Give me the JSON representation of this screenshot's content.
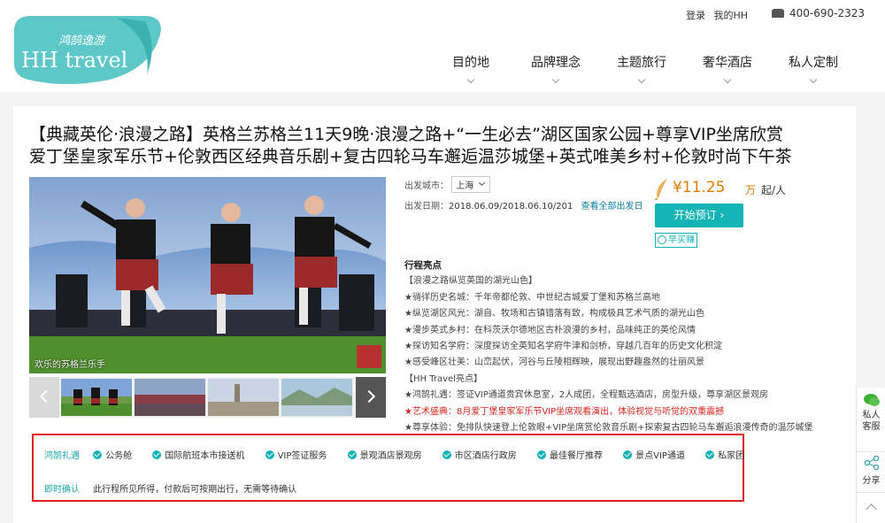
{
  "header": {
    "login": "登录",
    "my_hh": "我的HH",
    "phone": "400-690-2323",
    "logo_cn": "鸿鹄逸游",
    "logo_en": "HH travel",
    "nav": [
      {
        "label": "目的地"
      },
      {
        "label": "品牌理念"
      },
      {
        "label": "主题旅行"
      },
      {
        "label": "奢华酒店"
      },
      {
        "label": "私人定制"
      }
    ]
  },
  "product": {
    "title_line1": "【典藏英伦·浪漫之路】英格兰苏格兰11天9晚·浪漫之路+“一生必去”湖区国家公园+尊享VIP坐席欣赏",
    "title_line2": "爱丁堡皇家军乐节+伦敦西区经典音乐剧+复古四轮马车邂逅温莎城堡+英式唯美乡村+伦敦时尚下午茶",
    "photo_caption": "欢乐的苏格兰乐手",
    "departure_label": "出发城市：",
    "departure_value": "上海",
    "date_label": "出发日期：",
    "date_value": "2018.06.09/2018.06.10/201",
    "all_dates_link": "查看全部出发日",
    "price": "¥11.25",
    "price_unit": "万",
    "price_per": "起/人",
    "book_button": "开始预订",
    "early_button": "早买赚"
  },
  "highlights": {
    "title": "行程亮点",
    "lines": [
      "【浪漫之路纵览英国的湖光山色】",
      "★徜徉历史名城：千年帝都伦敦、中世纪古城爱丁堡和苏格兰高地",
      "★纵览湖区风光：湖自、牧场和古镇错落有致，构成极具艺术气质的湖光山色",
      "★漫步英式乡村：在科茨沃尔德地区古朴浪漫的乡村，品味纯正的英伦风情",
      "★探访知名学府：深度探访全英知名学府牛津和剑桥，穿越几百年的历史文化积淀",
      "★感受峰区壮美：山峦起伏，河谷与丘陵相辉映，展现出野趣盎然的壮丽风景",
      "【HH Travel亮点】",
      "★鸿鹄礼遇：签证VIP通道贵宾休息室，2人成团，全程甄选酒店，房型升级，尊享湖区景观房"
    ],
    "red_line": "★艺术盛典：8月爱丁堡皇家军乐节VIP坐席观看演出，体验视觉与听觉的双重震撼",
    "last_line": "★尊享体验：免排队快速登上伦敦眼+VIP坐席赏伦敦音乐剧+探索复古四轮马车邂逅浪漫传奇的温莎城堡"
  },
  "perks": {
    "label": "鸿鹄礼遇",
    "items": [
      "公务舱",
      "国际航班本市接送机",
      "VIP签证服务",
      "景观酒店景观房",
      "市区酒店行政房",
      "最佳餐厅推荐",
      "景点VIP通道",
      "私家团"
    ],
    "confirm_label": "即时确认",
    "confirm_text": "此行程所见所得，付款后可按期出行，无需等待确认"
  },
  "sidebar": {
    "service": "私人客服",
    "share": "分享"
  },
  "colors": {
    "accent": "#16b3b5",
    "price": "#e07b00",
    "alert": "#d9231c"
  }
}
